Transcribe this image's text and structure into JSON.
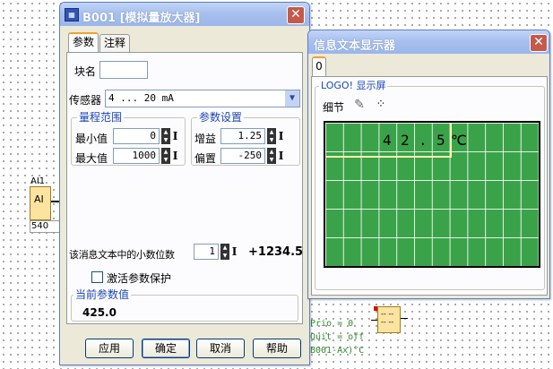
{
  "diagram": {
    "ai_block_label": "AI1",
    "ai_block_text": "AI",
    "ai_value": "540",
    "message_lines": [
      "Prio = 0",
      "Quit = off",
      "B001-Ax)°C"
    ],
    "message_block_text": [
      "-- --",
      "-- --"
    ]
  },
  "amplifier_dialog": {
    "title": "B001 [模拟量放大器]",
    "tabs": [
      "参数",
      "注释"
    ],
    "block_name_label": "块名",
    "block_name_value": "",
    "sensor_label": "传感器",
    "sensor_value": "4 ... 20 mA",
    "range_group": {
      "title": "量程范围",
      "min_label": "最小值",
      "min_value": "0",
      "max_label": "最大值",
      "max_value": "1000"
    },
    "param_group": {
      "title": "参数设置",
      "gain_label": "增益",
      "gain_value": "1.25",
      "offset_label": "偏置",
      "offset_value": "-250"
    },
    "decimals_label": "该消息文本中的小数位数",
    "decimals_value": "1",
    "decimals_preview": "+1234.5",
    "protection_label": "激活参数保护",
    "protection_checked": false,
    "current_value_title": "当前参数值",
    "current_value": "425.0",
    "buttons": {
      "apply": "应用",
      "ok": "确定",
      "cancel": "取消",
      "help": "帮助"
    }
  },
  "display_window": {
    "title": "信息文本显示器",
    "tab_label": "0",
    "group_title": "LOGO! 显示屏",
    "detail_label": "细节",
    "lcd_chars": [
      "4",
      "2",
      ".",
      "5",
      "℃"
    ]
  },
  "icons": {
    "close": "close-icon",
    "edit": "edit-pencil-icon",
    "detail": "detail-toggle-icon",
    "dropdown": "chevron-down-icon",
    "app": "block-app-icon"
  },
  "colors": {
    "lcd_green": "#3aa349",
    "legend_blue": "#1e46b4",
    "close_red": "#c45a4b",
    "titlebar_blue": "#a8c0ee",
    "block_fill": "#fde3a0"
  }
}
